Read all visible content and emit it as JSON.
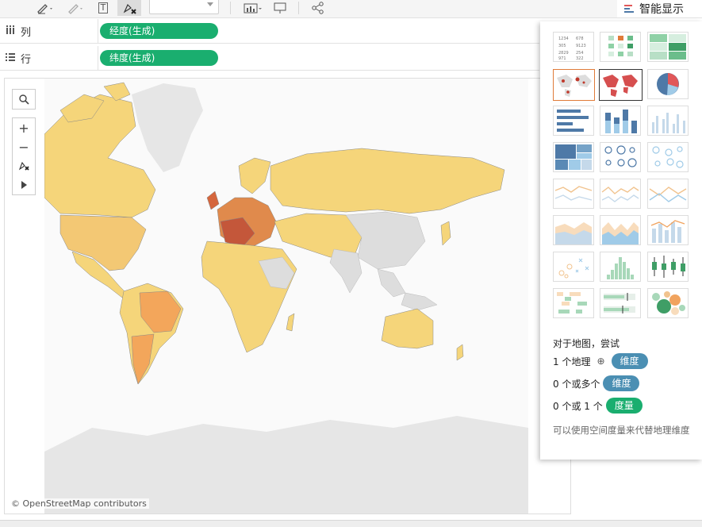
{
  "toolbar": {
    "buttons": [
      "highlight-icon",
      "annotate-icon",
      "text-icon",
      "clear-pins-icon",
      "chart-icon",
      "present-icon",
      "share-icon"
    ],
    "text_btn": "T",
    "selected_option": ""
  },
  "smart_show": {
    "label": "智能显示",
    "accent": "#e15759"
  },
  "shelves": {
    "columns": {
      "label": "列",
      "pill": "经度(生成)",
      "pill_color": "#1aae6f"
    },
    "rows": {
      "label": "行",
      "pill": "纬度(生成)",
      "pill_color": "#1aae6f"
    }
  },
  "map": {
    "attribution": "© OpenStreetMap contributors",
    "base_color": "#e6e6e6",
    "fill_low": "#f5d57a",
    "fill_mid": "#f3a65b",
    "fill_high": "#c4573a",
    "no_data": "#dddddd"
  },
  "panel": {
    "hint_title": "对于地图，尝试",
    "rows": [
      {
        "count": "1 个地理",
        "globe": "⊕",
        "pill": "维度",
        "color": "#4b8fb3"
      },
      {
        "count": "0 个或多个",
        "pill": "维度",
        "color": "#4b8fb3"
      },
      {
        "count": "0 个或 1 个",
        "pill": "度量",
        "color": "#1aae6f"
      }
    ],
    "note": "可以使用空间度量来代替地理维度"
  }
}
